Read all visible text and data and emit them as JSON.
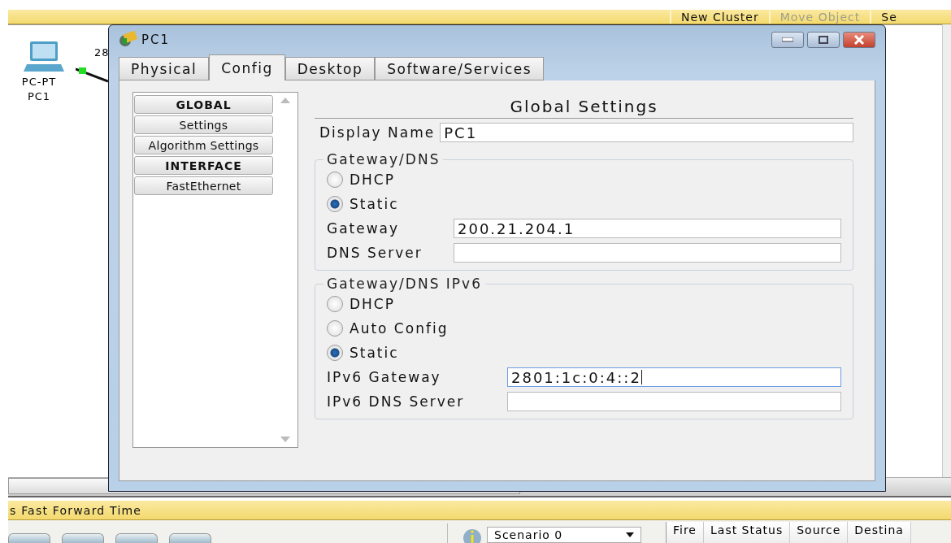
{
  "toolbar": {
    "items": [
      {
        "label": "New Cluster",
        "disabled": false
      },
      {
        "label": "Move Object",
        "disabled": true
      },
      {
        "label": "Se",
        "disabled": false
      }
    ]
  },
  "workspace": {
    "device": {
      "type_label": "PC-PT",
      "name": "PC1"
    },
    "port_label": "28",
    "link_up": true
  },
  "dialog": {
    "title": "PC1",
    "tabs": [
      {
        "label": "Physical",
        "selected": false
      },
      {
        "label": "Config",
        "selected": true
      },
      {
        "label": "Desktop",
        "selected": false
      },
      {
        "label": "Software/Services",
        "selected": false
      }
    ],
    "sidebar": [
      {
        "label": "GLOBAL",
        "kind": "header"
      },
      {
        "label": "Settings",
        "kind": "item"
      },
      {
        "label": "Algorithm Settings",
        "kind": "item"
      },
      {
        "label": "INTERFACE",
        "kind": "header"
      },
      {
        "label": "FastEthernet",
        "kind": "item"
      }
    ],
    "heading": "Global Settings",
    "display_name": {
      "label": "Display Name",
      "value": "PC1"
    },
    "groups": [
      {
        "title": "Gateway/DNS",
        "options": [
          {
            "label": "DHCP",
            "selected": false
          },
          {
            "label": "Static",
            "selected": true
          }
        ],
        "fields": [
          {
            "label": "Gateway",
            "value": "200.21.204.1",
            "focused": false
          },
          {
            "label": "DNS Server",
            "focused": false
          }
        ]
      },
      {
        "title": "Gateway/DNS IPv6",
        "options": [
          {
            "label": "DHCP",
            "selected": false
          },
          {
            "label": "Auto Config",
            "selected": false
          },
          {
            "label": "Static",
            "selected": true
          }
        ],
        "fields": [
          {
            "label": "IPv6 Gateway",
            "value": "2801:1c:0:4::2",
            "focused": true
          },
          {
            "label": "IPv6 DNS Server",
            "focused": false
          }
        ]
      }
    ]
  },
  "realtime_bar": {
    "text": "s Fast Forward Time"
  },
  "scenario": {
    "value": "Scenario 0"
  },
  "pdu_table": {
    "columns": [
      "Fire",
      "Last Status",
      "Source",
      "Destina"
    ]
  }
}
